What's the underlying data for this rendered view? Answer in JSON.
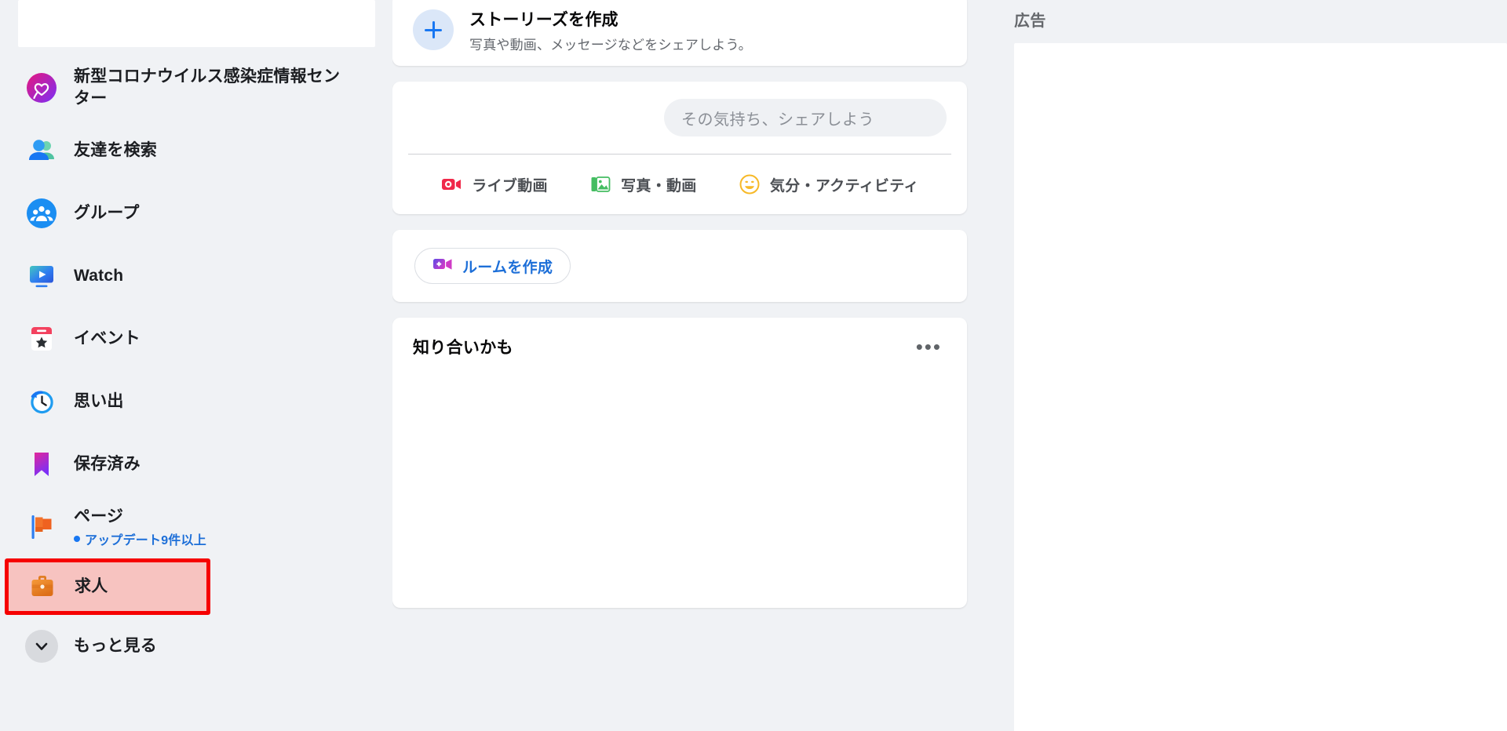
{
  "sidebar": {
    "items": [
      {
        "label": "新型コロナウイルス感染症情報センター",
        "icon": "covid-heart-icon",
        "sub": null,
        "highlighted": false
      },
      {
        "label": "友達を検索",
        "icon": "friends-icon",
        "sub": null,
        "highlighted": false
      },
      {
        "label": "グループ",
        "icon": "groups-icon",
        "sub": null,
        "highlighted": false
      },
      {
        "label": "Watch",
        "icon": "watch-icon",
        "sub": null,
        "highlighted": false
      },
      {
        "label": "イベント",
        "icon": "events-calendar-icon",
        "sub": null,
        "highlighted": false
      },
      {
        "label": "思い出",
        "icon": "memories-clock-icon",
        "sub": null,
        "highlighted": false
      },
      {
        "label": "保存済み",
        "icon": "saved-bookmark-icon",
        "sub": null,
        "highlighted": false
      },
      {
        "label": "ページ",
        "icon": "pages-flag-icon",
        "sub": "アップデート9件以上",
        "highlighted": false
      },
      {
        "label": "求人",
        "icon": "jobs-briefcase-icon",
        "sub": null,
        "highlighted": true
      },
      {
        "label": "もっと見る",
        "icon": "chevron-down-icon",
        "sub": null,
        "highlighted": false
      }
    ]
  },
  "feed": {
    "story": {
      "title": "ストーリーズを作成",
      "subtitle": "写真や動画、メッセージなどをシェアしよう。",
      "plus_icon": "plus-icon"
    },
    "composer": {
      "placeholder": "その気持ち、シェアしよう",
      "actions": [
        {
          "label": "ライブ動画",
          "icon": "live-video-icon",
          "color": "#f02849"
        },
        {
          "label": "写真・動画",
          "icon": "photo-video-icon",
          "color": "#45bd62"
        },
        {
          "label": "気分・アクティビティ",
          "icon": "feeling-activity-icon",
          "color": "#f7b928"
        }
      ]
    },
    "room": {
      "label": "ルームを作成",
      "icon": "create-room-icon"
    },
    "pymk": {
      "title": "知り合いかも",
      "menu_dots": "•••"
    }
  },
  "rail": {
    "title": "広告"
  },
  "colors": {
    "page_bg": "#f0f2f5",
    "card_bg": "#ffffff",
    "accent_blue": "#1877f2",
    "highlight_border": "#f60000",
    "highlight_fill": "#f7c3c0",
    "text_primary": "#080809",
    "text_secondary": "#65686c"
  }
}
